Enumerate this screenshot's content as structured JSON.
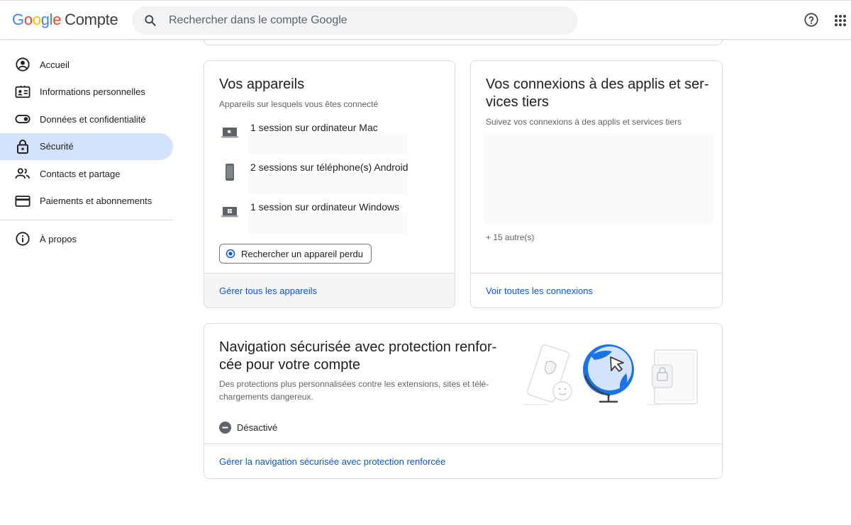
{
  "header": {
    "logo_google": "Google",
    "logo_product": "Compte",
    "search_placeholder": "Rechercher dans le compte Google",
    "help_icon": "help-circle-icon",
    "apps_icon": "apps-grid-icon"
  },
  "sidebar": {
    "items": [
      {
        "label": "Accueil",
        "icon": "account-circle-icon",
        "active": false
      },
      {
        "label": "Informations personnelles",
        "icon": "id-card-icon",
        "active": false
      },
      {
        "label": "Données et confidentialité",
        "icon": "toggle-icon",
        "active": false
      },
      {
        "label": "Sécurité",
        "icon": "lock-icon",
        "active": true
      },
      {
        "label": "Contacts et partage",
        "icon": "people-icon",
        "active": false
      },
      {
        "label": "Paiements et abonnements",
        "icon": "credit-card-icon",
        "active": false
      }
    ],
    "about": {
      "label": "À propos",
      "icon": "info-icon"
    }
  },
  "devices_card": {
    "title": "Vos appareils",
    "subtitle": "Appareils sur lesquels vous êtes connecté",
    "devices": [
      {
        "label": "1 session sur ordinateur Mac",
        "icon": "mac-laptop-icon"
      },
      {
        "label": "2 sessions sur téléphone(s) Android",
        "icon": "android-phone-icon"
      },
      {
        "label": "1 session sur ordinateur Windows",
        "icon": "windows-laptop-icon"
      }
    ],
    "find_button": "Rechercher un appareil perdu",
    "footer_link": "Gérer tous les appareils"
  },
  "connections_card": {
    "title": "Vos connexions à des applis et ser­vices tiers",
    "title_line1": "Vos connexions à des applis et ser-",
    "title_line2": "vices tiers",
    "subtitle": "Suivez vos connexions à des applis et services tiers",
    "more_count": "+ 15 autre(s)",
    "footer_link": "Voir toutes les connexions"
  },
  "safe_browsing_card": {
    "title_line1": "Navigation sécurisée avec protection renfor-",
    "title_line2": "cée pour votre compte",
    "desc_line1": "Des protections plus personnalisées contre les extensions, sites et télé-",
    "desc_line2": "chargements dangereux.",
    "status": "Désactivé",
    "footer_link": "Gérer la navigation sécurisée avec protection renforcée"
  },
  "colors": {
    "accent_link": "#0b57d0",
    "active_nav_bg": "#d3e3fd",
    "border": "#dadce0"
  }
}
